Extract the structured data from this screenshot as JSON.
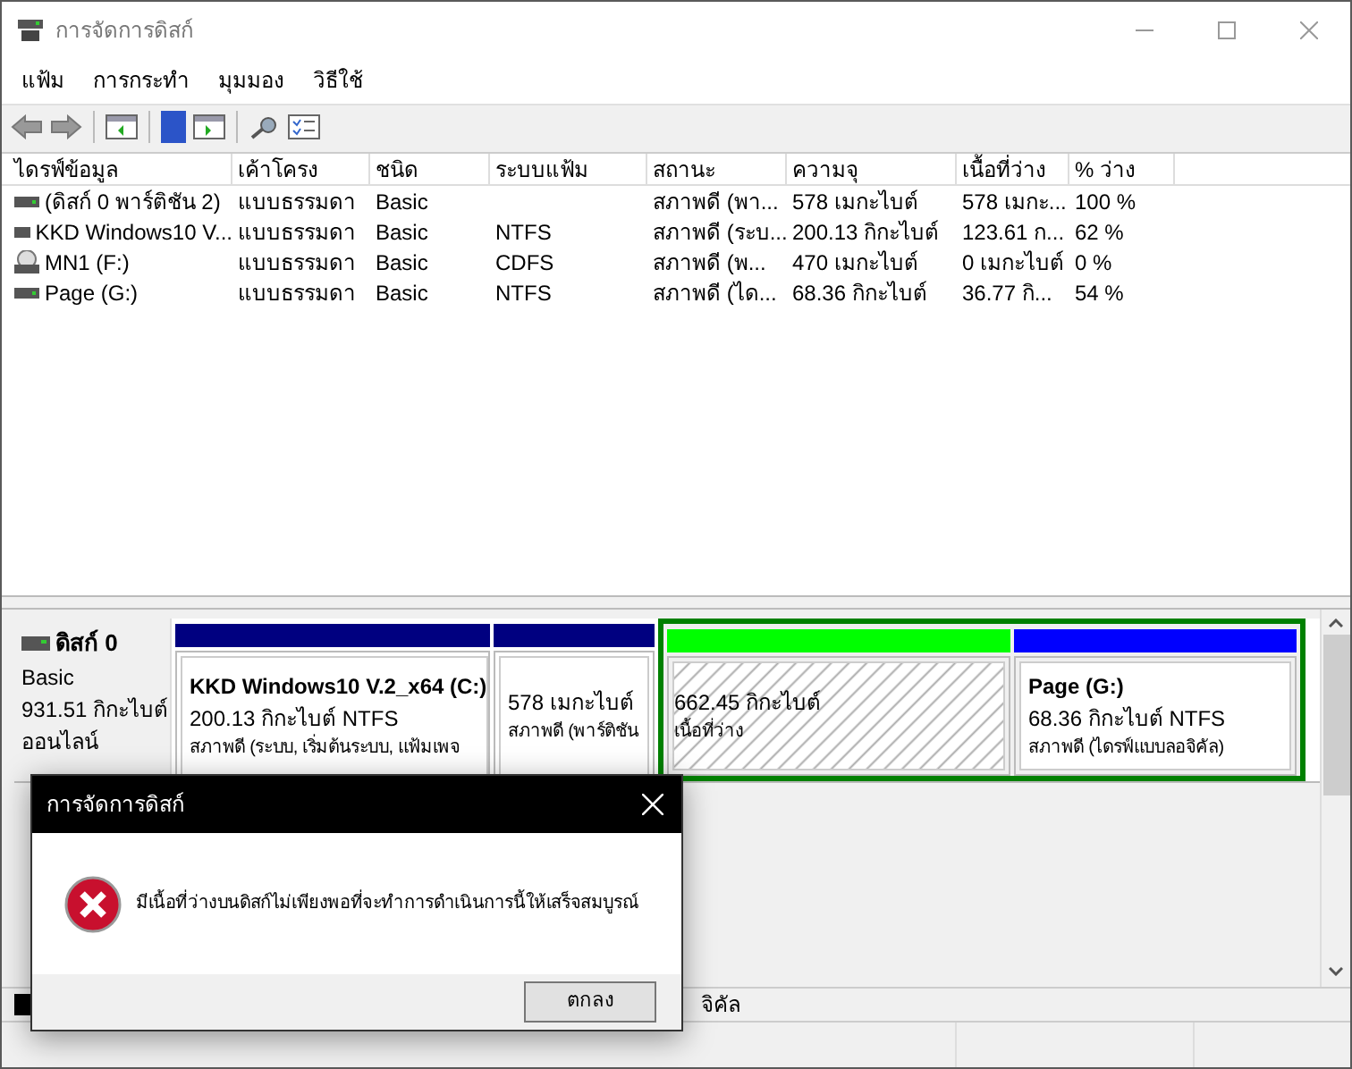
{
  "window": {
    "title": "การจัดการดิสก์"
  },
  "menu": [
    "แฟ้ม",
    "การกระทำ",
    "มุมมอง",
    "วิธีใช้"
  ],
  "volumes": {
    "columns": [
      "ไดรฟ์ข้อมูล",
      "เค้าโครง",
      "ชนิด",
      "ระบบแฟ้ม",
      "สถานะ",
      "ความจุ",
      "เนื้อที่ว่าง",
      "% ว่าง"
    ],
    "rows": [
      {
        "kind": "disk",
        "cells": [
          "(ดิสก์ 0 พาร์ติชัน 2)",
          "แบบธรรมดา",
          "Basic",
          "",
          "สภาพดี (พา...",
          "578 เมกะไบต์",
          "578 เมกะ...",
          "100 %"
        ]
      },
      {
        "kind": "disk",
        "cells": [
          "KKD Windows10 V...",
          "แบบธรรมดา",
          "Basic",
          "NTFS",
          "สภาพดี (ระบ...",
          "200.13 กิกะไบต์",
          "123.61 ก...",
          "62 %"
        ]
      },
      {
        "kind": "cd",
        "cells": [
          "MN1 (F:)",
          "แบบธรรมดา",
          "Basic",
          "CDFS",
          "สภาพดี (พ...",
          "470 เมกะไบต์",
          "0 เมกะไบต์",
          "0 %"
        ]
      },
      {
        "kind": "disk",
        "cells": [
          "Page (G:)",
          "แบบธรรมดา",
          "Basic",
          "NTFS",
          "สภาพดี (ได...",
          "68.36 กิกะไบต์",
          "36.77 กิ...",
          "54 %"
        ]
      }
    ]
  },
  "disk": {
    "name": "ดิสก์ 0",
    "type": "Basic",
    "size": "931.51 กิกะไบต์",
    "status": "ออนไลน์",
    "partitions": [
      {
        "kind": "primary",
        "title": "KKD Windows10 V.2_x64  (C:)",
        "size": "200.13 กิกะไบต์ NTFS",
        "status": "สภาพดี (ระบบ, เริ่มต้นระบบ, แฟ้มเพจ"
      },
      {
        "kind": "primary",
        "size": "578 เมกะไบต์",
        "status": "สภาพดี (พาร์ติชัน"
      },
      {
        "kind": "free",
        "size": "662.45 กิกะไบต์",
        "status": "เนื้อที่ว่าง"
      },
      {
        "kind": "logical",
        "title": "Page  (G:)",
        "size": "68.36 กิกะไบต์ NTFS",
        "status": "สภาพดี (ไดรฟ์แบบลอจิคัล)"
      }
    ]
  },
  "legend": {
    "label": "จิคัล"
  },
  "dialog": {
    "title": "การจัดการดิสก์",
    "message": "มีเนื้อที่ว่างบนดิสก์ไม่เพียงพอที่จะทำการดำเนินการนี้ให้เสร็จสมบูรณ์",
    "button": "ตกลง"
  }
}
